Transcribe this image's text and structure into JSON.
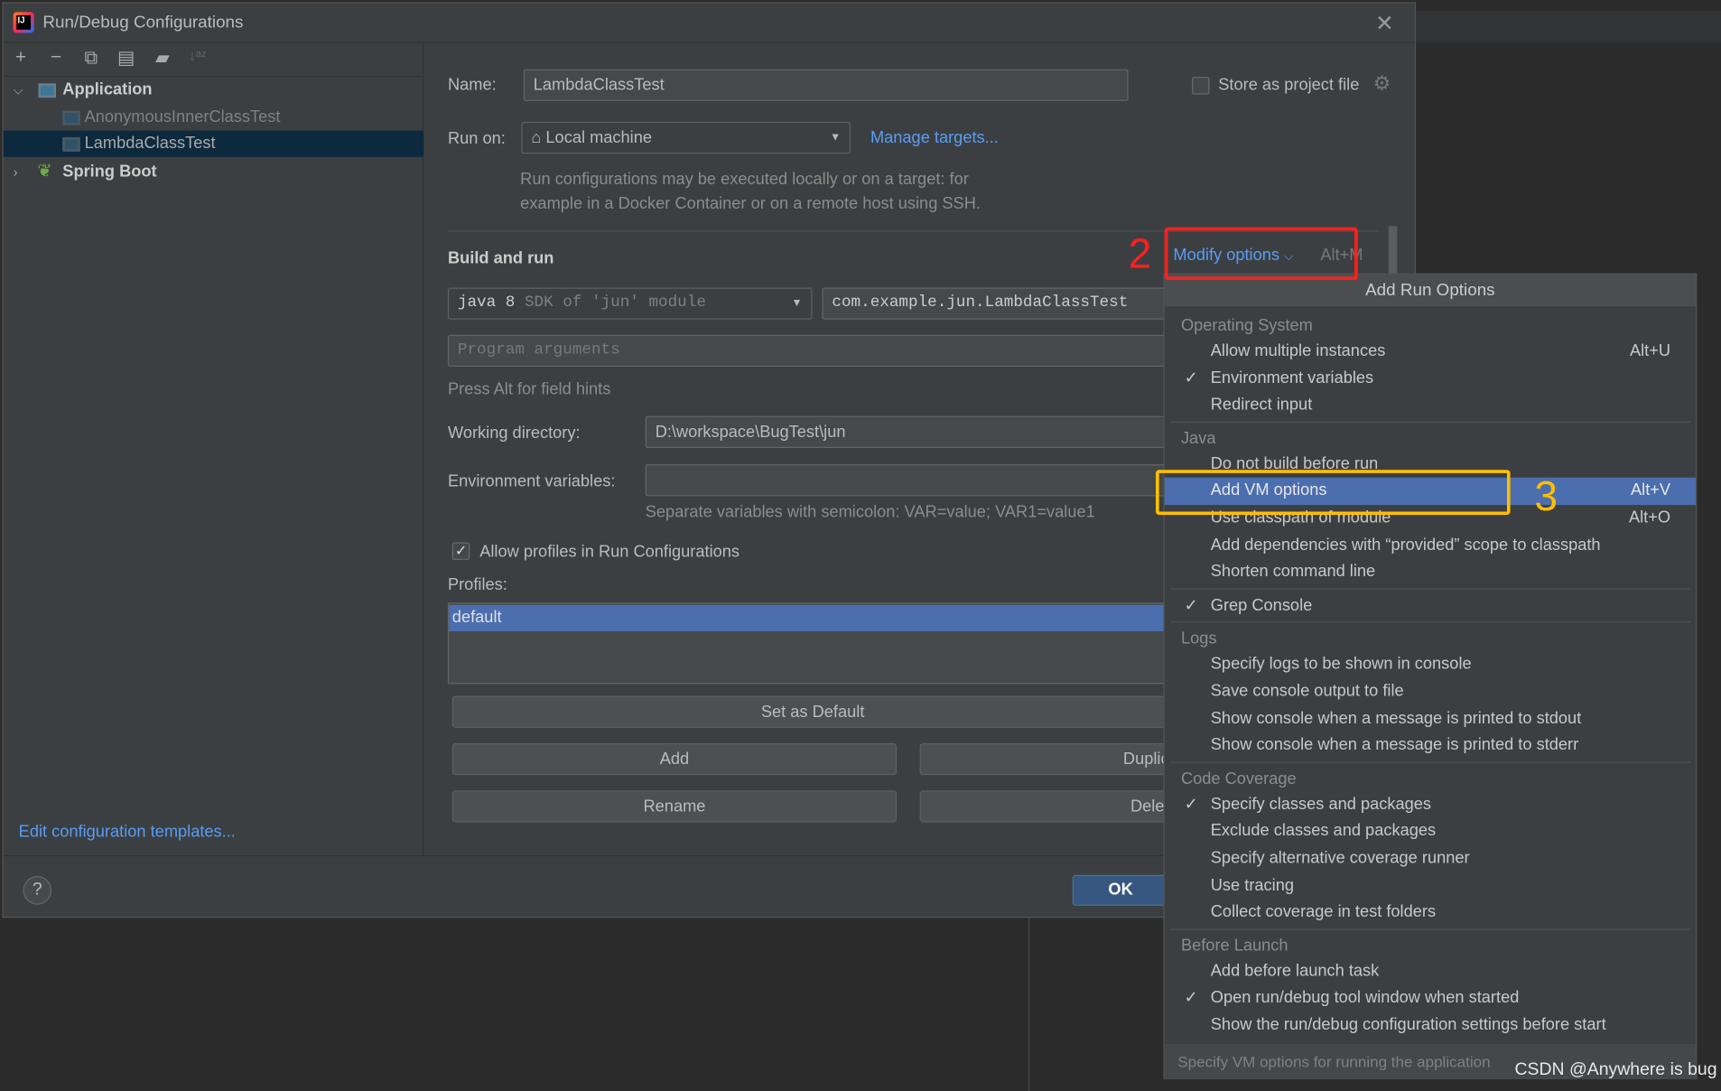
{
  "dialog": {
    "title": "Run/Debug Configurations"
  },
  "toolbar": {
    "add": "+",
    "remove": "−",
    "copy": "⧉",
    "save": "▤",
    "folder": "▰",
    "sort": "↓ᵃᶻ"
  },
  "tree": {
    "group": "Application",
    "items": [
      "AnonymousInnerClassTest",
      "LambdaClassTest"
    ],
    "selected": "LambdaClassTest",
    "spring": "Spring Boot"
  },
  "left": {
    "templates_link": "Edit configuration templates..."
  },
  "form": {
    "name_label": "Name:",
    "name_value": "LambdaClassTest",
    "store_label": "Store as project file",
    "store_checked": false,
    "runon_label": "Run on:",
    "runon_value": "Local machine",
    "manage_link": "Manage targets...",
    "runon_hint1": "Run configurations may be executed locally or on a target: for",
    "runon_hint2": "example in a Docker Container or on a remote host using SSH.",
    "build_title": "Build and run",
    "modify_label": "Modify options",
    "modify_shortcut": "Alt+M",
    "jdk_main": "java 8",
    "jdk_hint": "SDK of 'jun' module",
    "main_class": "com.example.jun.LambdaClassTest",
    "args_placeholder": "Program arguments",
    "alt_hint": "Press Alt for field hints",
    "wd_label": "Working directory:",
    "wd_value": "D:\\workspace\\BugTest\\jun",
    "env_label": "Environment variables:",
    "env_value": "",
    "env_hint": "Separate variables with semicolon: VAR=value; VAR1=value1",
    "profiles_check": "Allow profiles in Run Configurations",
    "profiles_checked": true,
    "profiles_label": "Profiles:",
    "profiles": [
      "default"
    ],
    "set_default": "Set as Default",
    "add": "Add",
    "duplicate": "Duplic",
    "rename": "Rename",
    "delete": "Delet"
  },
  "bottom": {
    "help": "?",
    "ok": "OK"
  },
  "popup": {
    "title": "Add Run Options",
    "sections": [
      {
        "header": "Operating System",
        "items": [
          {
            "label": "Allow multiple instances",
            "shortcut": "Alt+U"
          },
          {
            "label": "Environment variables",
            "checked": true
          },
          {
            "label": "Redirect input"
          }
        ]
      },
      {
        "header": "Java",
        "items": [
          {
            "label": "Do not build before run"
          },
          {
            "label": "Add VM options",
            "shortcut": "Alt+V",
            "highlighted": true
          },
          {
            "label": "Use classpath of module",
            "shortcut": "Alt+O"
          },
          {
            "label": "Add dependencies with “provided” scope to classpath"
          },
          {
            "label": "Shorten command line"
          }
        ]
      },
      {
        "header": "",
        "items": [
          {
            "label": "Grep Console",
            "checked": true
          }
        ]
      },
      {
        "header": "Logs",
        "items": [
          {
            "label": "Specify logs to be shown in console"
          },
          {
            "label": "Save console output to file"
          },
          {
            "label": "Show console when a message is printed to stdout"
          },
          {
            "label": "Show console when a message is printed to stderr"
          }
        ]
      },
      {
        "header": "Code Coverage",
        "items": [
          {
            "label": "Specify classes and packages",
            "checked": true
          },
          {
            "label": "Exclude classes and packages"
          },
          {
            "label": "Specify alternative coverage runner"
          },
          {
            "label": "Use tracing"
          },
          {
            "label": "Collect coverage in test folders"
          }
        ]
      },
      {
        "header": "Before Launch",
        "items": [
          {
            "label": "Add before launch task"
          },
          {
            "label": "Open run/debug tool window when started",
            "checked": true
          },
          {
            "label": "Show the run/debug configuration settings before start"
          }
        ]
      }
    ],
    "footer": "Specify VM options for running the application"
  },
  "annotations": {
    "step2": "2",
    "step3": "3",
    "step2_color": "#ff1f1f",
    "step3_color": "#ffbf00"
  },
  "watermark": "CSDN @Anywhere is bug",
  "colors": {
    "accent": "#4b6eaf",
    "link": "#589df6",
    "selection": "#0d293e"
  }
}
